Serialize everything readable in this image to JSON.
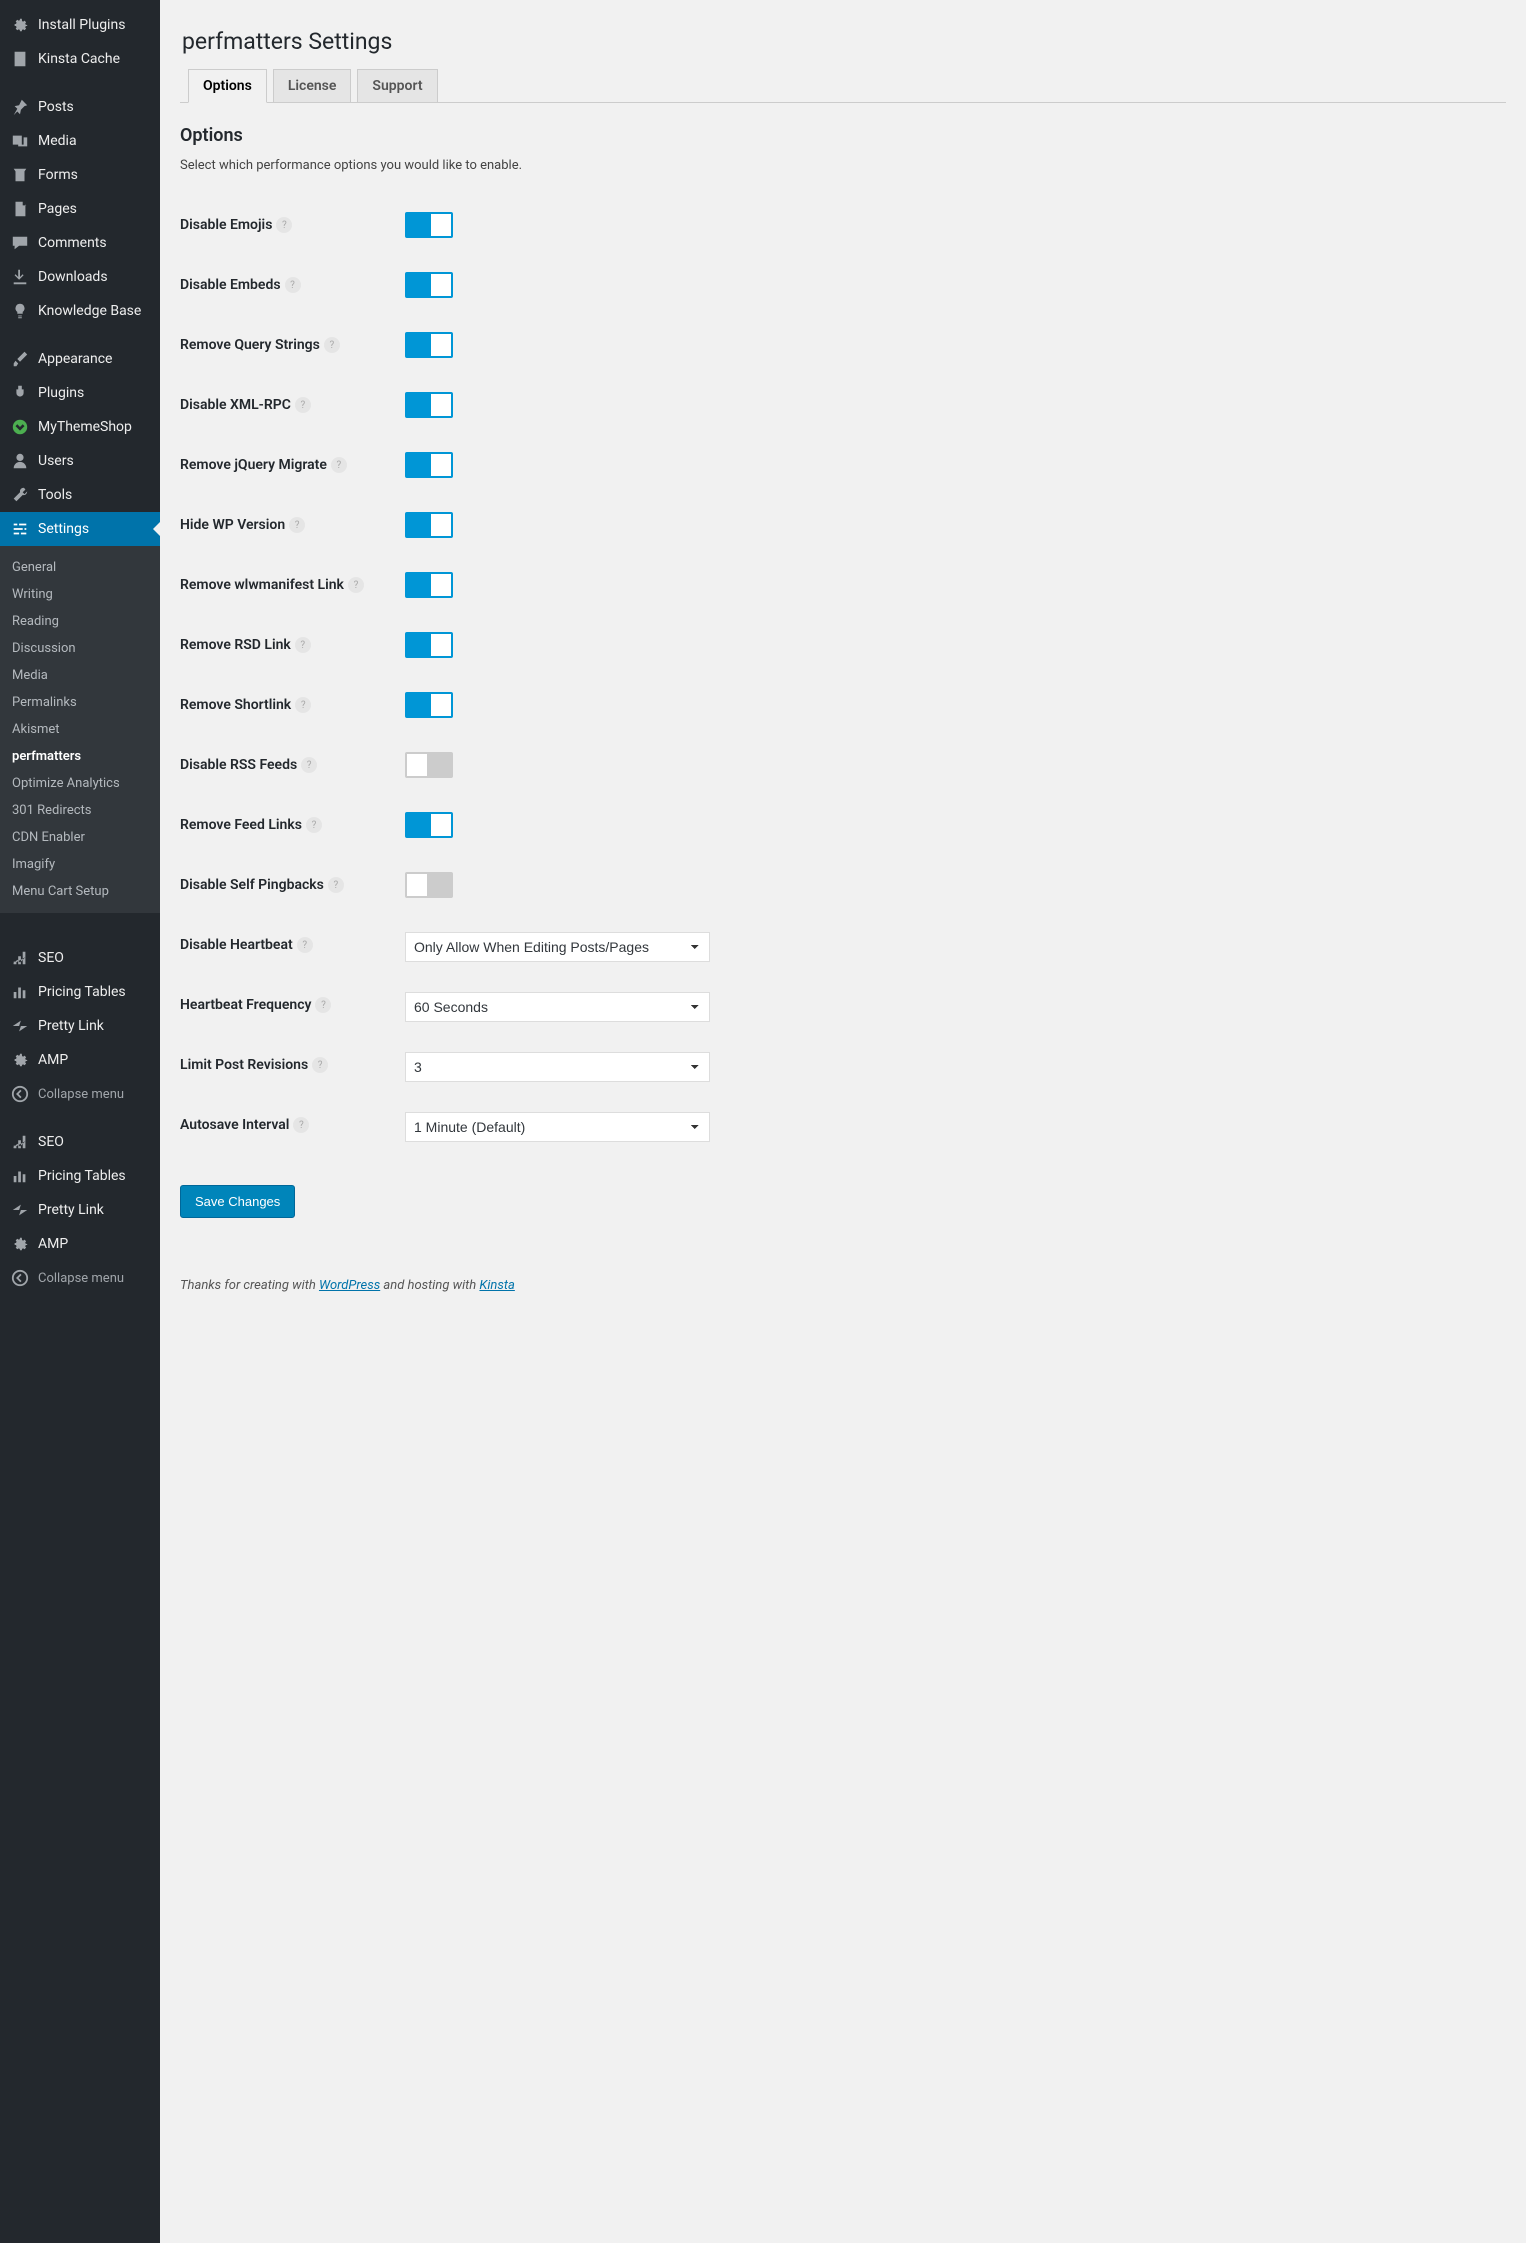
{
  "sidebar": {
    "items": [
      {
        "label": "Install Plugins",
        "icon": "gear-icon"
      },
      {
        "label": "Kinsta Cache",
        "icon": "doc-icon"
      },
      {
        "label": "Posts",
        "icon": "pin-icon",
        "sep": true
      },
      {
        "label": "Media",
        "icon": "media-icon"
      },
      {
        "label": "Forms",
        "icon": "forms-icon"
      },
      {
        "label": "Pages",
        "icon": "pages-icon"
      },
      {
        "label": "Comments",
        "icon": "comment-icon"
      },
      {
        "label": "Downloads",
        "icon": "download-icon"
      },
      {
        "label": "Knowledge Base",
        "icon": "bulb-icon"
      },
      {
        "label": "Appearance",
        "icon": "brush-icon",
        "sep": true
      },
      {
        "label": "Plugins",
        "icon": "plug-icon"
      },
      {
        "label": "MyThemeShop",
        "icon": "mts-icon"
      },
      {
        "label": "Users",
        "icon": "user-icon"
      },
      {
        "label": "Tools",
        "icon": "wrench-icon"
      },
      {
        "label": "Settings",
        "icon": "sliders-icon",
        "selected": true
      }
    ],
    "submenu": [
      "General",
      "Writing",
      "Reading",
      "Discussion",
      "Media",
      "Permalinks",
      "Akismet",
      "perfmatters",
      "Optimize Analytics",
      "301 Redirects",
      "CDN Enabler",
      "Imagify",
      "Menu Cart Setup"
    ],
    "submenu_active": "perfmatters",
    "items2": [
      {
        "label": "SEO",
        "icon": "seo-icon",
        "sep": true
      },
      {
        "label": "Pricing Tables",
        "icon": "bars-icon"
      },
      {
        "label": "Pretty Link",
        "icon": "star-icon"
      },
      {
        "label": "AMP",
        "icon": "gear-icon"
      },
      {
        "label": "Collapse menu",
        "icon": "collapse-icon",
        "collapse": true
      },
      {
        "label": "SEO",
        "icon": "seo-icon",
        "sep": true
      },
      {
        "label": "Pricing Tables",
        "icon": "bars-icon"
      },
      {
        "label": "Pretty Link",
        "icon": "star-icon"
      },
      {
        "label": "AMP",
        "icon": "gear-icon"
      },
      {
        "label": "Collapse menu",
        "icon": "collapse-icon",
        "collapse": true
      }
    ]
  },
  "page": {
    "title": "perfmatters Settings",
    "tabs": [
      {
        "label": "Options",
        "active": true
      },
      {
        "label": "License"
      },
      {
        "label": "Support"
      }
    ],
    "section_title": "Options",
    "section_desc": "Select which performance options you would like to enable.",
    "rows": [
      {
        "label": "Disable Emojis",
        "type": "toggle",
        "value": true
      },
      {
        "label": "Disable Embeds",
        "type": "toggle",
        "value": true
      },
      {
        "label": "Remove Query Strings",
        "type": "toggle",
        "value": true
      },
      {
        "label": "Disable XML-RPC",
        "type": "toggle",
        "value": true
      },
      {
        "label": "Remove jQuery Migrate",
        "type": "toggle",
        "value": true
      },
      {
        "label": "Hide WP Version",
        "type": "toggle",
        "value": true
      },
      {
        "label": "Remove wlwmanifest Link",
        "type": "toggle",
        "value": true
      },
      {
        "label": "Remove RSD Link",
        "type": "toggle",
        "value": true
      },
      {
        "label": "Remove Shortlink",
        "type": "toggle",
        "value": true
      },
      {
        "label": "Disable RSS Feeds",
        "type": "toggle",
        "value": false
      },
      {
        "label": "Remove Feed Links",
        "type": "toggle",
        "value": true
      },
      {
        "label": "Disable Self Pingbacks",
        "type": "toggle",
        "value": false
      },
      {
        "label": "Disable Heartbeat",
        "type": "select",
        "value": "Only Allow When Editing Posts/Pages"
      },
      {
        "label": "Heartbeat Frequency",
        "type": "select",
        "value": "60 Seconds"
      },
      {
        "label": "Limit Post Revisions",
        "type": "select",
        "value": "3"
      },
      {
        "label": "Autosave Interval",
        "type": "select",
        "value": "1 Minute (Default)"
      }
    ],
    "submit": "Save Changes",
    "footer": {
      "pre": "Thanks for creating with ",
      "link1": "WordPress",
      "mid": " and hosting with ",
      "link2": "Kinsta"
    }
  }
}
